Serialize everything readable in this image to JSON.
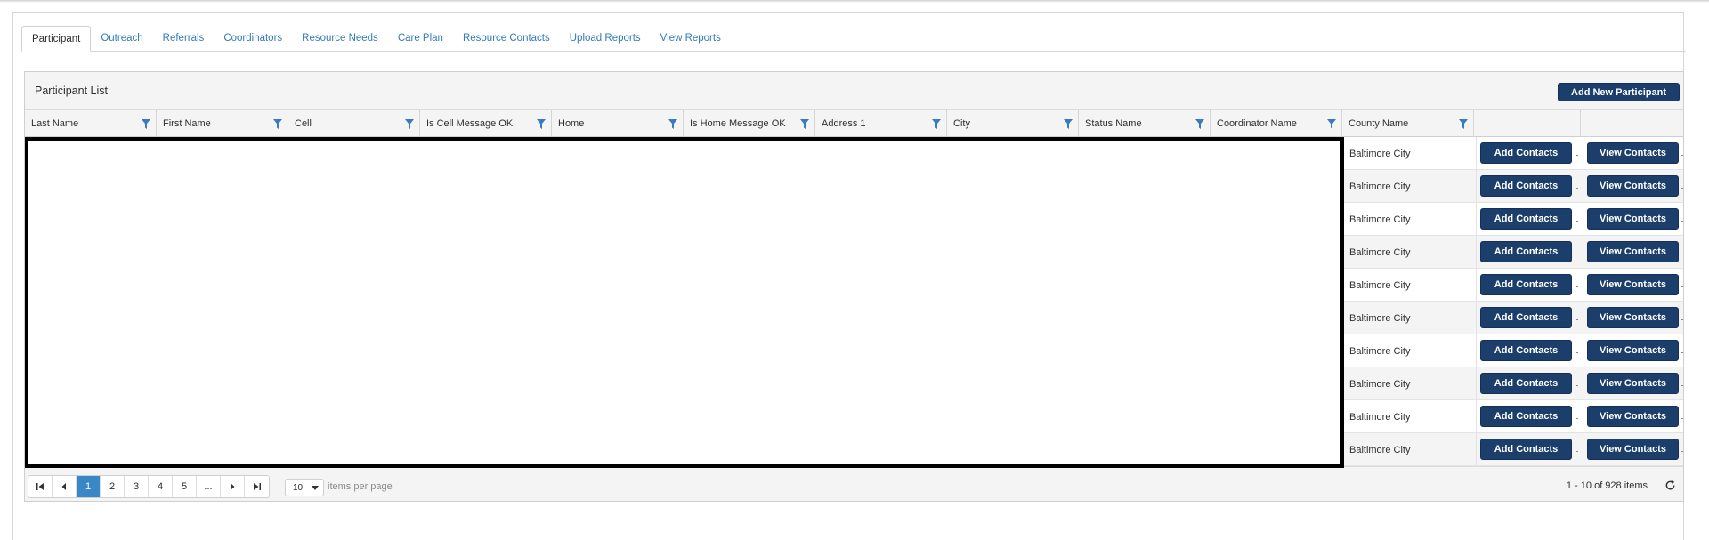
{
  "tabs": [
    {
      "label": "Participant",
      "active": true
    },
    {
      "label": "Outreach"
    },
    {
      "label": "Referrals"
    },
    {
      "label": "Coordinators"
    },
    {
      "label": "Resource Needs"
    },
    {
      "label": "Care Plan"
    },
    {
      "label": "Resource Contacts"
    },
    {
      "label": "Upload Reports"
    },
    {
      "label": "View Reports"
    }
  ],
  "grid": {
    "title": "Participant List",
    "add_button": "Add New Participant",
    "columns": [
      "Last Name",
      "First Name",
      "Cell",
      "Is Cell Message OK",
      "Home",
      "Is Home Message OK",
      "Address 1",
      "City",
      "Status Name",
      "Coordinator Name",
      "County Name"
    ],
    "rows": [
      {
        "county": "Baltimore City"
      },
      {
        "county": "Baltimore City"
      },
      {
        "county": "Baltimore City"
      },
      {
        "county": "Baltimore City"
      },
      {
        "county": "Baltimore City"
      },
      {
        "county": "Baltimore City"
      },
      {
        "county": "Baltimore City"
      },
      {
        "county": "Baltimore City"
      },
      {
        "county": "Baltimore City"
      },
      {
        "county": "Baltimore City"
      }
    ],
    "add_contacts_label": "Add Contacts",
    "view_contacts_label": "View Contacts"
  },
  "pager": {
    "pages": [
      "1",
      "2",
      "3",
      "4",
      "5",
      "..."
    ],
    "current_page": "1",
    "page_size": "10",
    "items_per_page_label": "items per page",
    "info": "1 - 10 of 928 items"
  },
  "colors": {
    "primary_button": "#1c3e6b",
    "link": "#337ab7",
    "current_page": "#3a87c8"
  }
}
